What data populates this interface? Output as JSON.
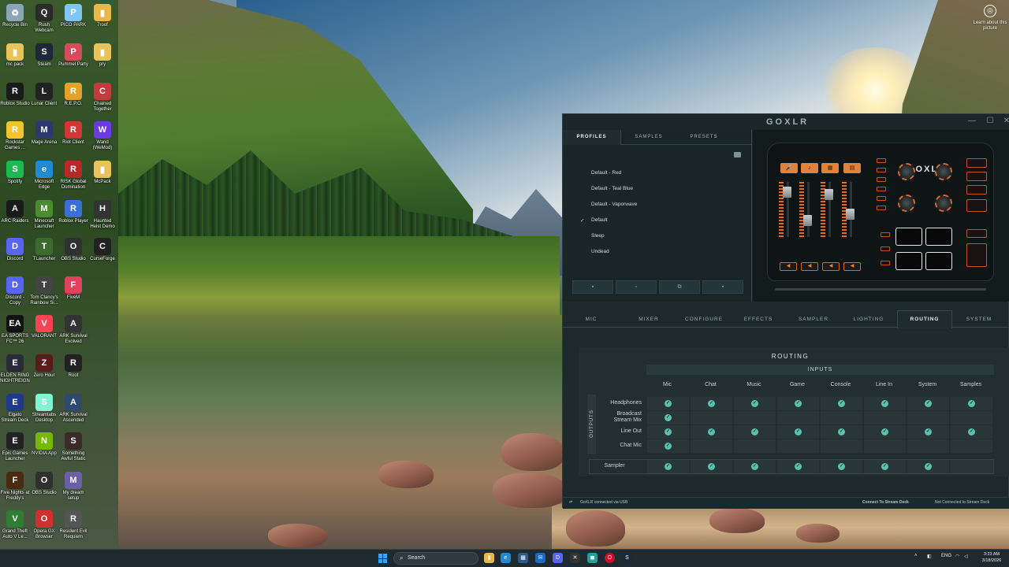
{
  "wallpaper": {
    "learn_more": "Learn about this picture"
  },
  "desktop_icons": [
    {
      "label": "Recycle Bin",
      "color": "#8aa6b8",
      "glyph": "♻"
    },
    {
      "label": "Rush Webcam",
      "color": "#2b2b2b",
      "glyph": "Q"
    },
    {
      "label": "PICO PARK",
      "color": "#7fc7f0",
      "glyph": "P"
    },
    {
      "label": "7roof",
      "color": "#e8b84a",
      "glyph": "▮"
    },
    {
      "label": "mc pack",
      "color": "#e8c25a",
      "glyph": "▮"
    },
    {
      "label": "Steam",
      "color": "#1b2838",
      "glyph": "S"
    },
    {
      "label": "Pummel Party",
      "color": "#d94b5b",
      "glyph": "P"
    },
    {
      "label": "pry",
      "color": "#e8c25a",
      "glyph": "▮"
    },
    {
      "label": "Roblox Studio",
      "color": "#1a1a1a",
      "glyph": "R"
    },
    {
      "label": "Lunar Client",
      "color": "#222",
      "glyph": "L"
    },
    {
      "label": "R.E.P.O.",
      "color": "#e3a32a",
      "glyph": "R"
    },
    {
      "label": "Chained Together",
      "color": "#c43b3b",
      "glyph": "C"
    },
    {
      "label": "Rockstar Games ...",
      "color": "#f4c430",
      "glyph": "R"
    },
    {
      "label": "Mage Arena",
      "color": "#2b3a6b",
      "glyph": "M"
    },
    {
      "label": "Riot Client",
      "color": "#d13639",
      "glyph": "R"
    },
    {
      "label": "Wand (WeMod)",
      "color": "#6a3be0",
      "glyph": "W"
    },
    {
      "label": "Spotify",
      "color": "#1db954",
      "glyph": "S"
    },
    {
      "label": "Microsoft Edge",
      "color": "#1f8ad6",
      "glyph": "e"
    },
    {
      "label": "RISK Global Domination",
      "color": "#b92828",
      "glyph": "R"
    },
    {
      "label": "McPack",
      "color": "#e8c25a",
      "glyph": "▮"
    },
    {
      "label": "ARC Raiders",
      "color": "#1a1a1a",
      "glyph": "A"
    },
    {
      "label": "Minecraft Launcher",
      "color": "#4b8a2e",
      "glyph": "M"
    },
    {
      "label": "Roblox Player",
      "color": "#3a6fd8",
      "glyph": "R"
    },
    {
      "label": "Haunted Heist Demo",
      "color": "#333",
      "glyph": "H"
    },
    {
      "label": "Discord",
      "color": "#5865f2",
      "glyph": "D"
    },
    {
      "label": "TLauncher",
      "color": "#3d6b2d",
      "glyph": "T"
    },
    {
      "label": "OBS Studio",
      "color": "#303030",
      "glyph": "O"
    },
    {
      "label": "CurseForge",
      "color": "#222",
      "glyph": "C"
    },
    {
      "label": "Discord - Copy",
      "color": "#5865f2",
      "glyph": "D"
    },
    {
      "label": "Tom Clancy's Rainbow Si...",
      "color": "#444",
      "glyph": "T"
    },
    {
      "label": "FiveM",
      "color": "#e0415c",
      "glyph": "F"
    },
    {
      "label": "",
      "color": "",
      "glyph": ""
    },
    {
      "label": "EA SPORTS FC™ 26",
      "color": "#111",
      "glyph": "EA"
    },
    {
      "label": "VALORANT",
      "color": "#fa4454",
      "glyph": "V"
    },
    {
      "label": "ARK Survival Evolved",
      "color": "#333",
      "glyph": "A"
    },
    {
      "label": "",
      "color": "",
      "glyph": ""
    },
    {
      "label": "ELDEN RING NIGHTREIGN",
      "color": "#2a2a3a",
      "glyph": "E"
    },
    {
      "label": "Zero Hour",
      "color": "#5a1a1a",
      "glyph": "Z"
    },
    {
      "label": "Root",
      "color": "#222",
      "glyph": "R"
    },
    {
      "label": "",
      "color": "",
      "glyph": ""
    },
    {
      "label": "Elgato Stream Deck",
      "color": "#1e3a8a",
      "glyph": "E"
    },
    {
      "label": "Streamlabs Desktop",
      "color": "#80f5d2",
      "glyph": "S"
    },
    {
      "label": "ARK Survival Ascended",
      "color": "#2d4a6b",
      "glyph": "A"
    },
    {
      "label": "",
      "color": "",
      "glyph": ""
    },
    {
      "label": "Epic Games Launcher",
      "color": "#222",
      "glyph": "E"
    },
    {
      "label": "NVIDIA App",
      "color": "#76b900",
      "glyph": "N"
    },
    {
      "label": "Something Awful Static",
      "color": "#3a2a2a",
      "glyph": "S"
    },
    {
      "label": "",
      "color": "",
      "glyph": ""
    },
    {
      "label": "Five Nights at Freddy's",
      "color": "#4a2a10",
      "glyph": "F"
    },
    {
      "label": "OBS Studio",
      "color": "#303030",
      "glyph": "O"
    },
    {
      "label": "My dream setup",
      "color": "#6b5fa8",
      "glyph": "M"
    },
    {
      "label": "",
      "color": "",
      "glyph": ""
    },
    {
      "label": "Grand Theft Auto V Le...",
      "color": "#2e7d32",
      "glyph": "V"
    },
    {
      "label": "Opera GX Browser",
      "color": "#d32f2f",
      "glyph": "O"
    },
    {
      "label": "Resident Evil Requiem",
      "color": "#555",
      "glyph": "R"
    }
  ],
  "goxlr": {
    "title": "GOXLR",
    "window_buttons": [
      "—",
      "☐",
      "✕"
    ],
    "tabs": [
      "PROFILES",
      "SAMPLES",
      "PRESETS"
    ],
    "profiles": [
      "Default - Red",
      "Default - Teal Blue",
      "Default - Vaporwave",
      "Default",
      "Sleep",
      "Undead"
    ],
    "active_profile_check": "✓",
    "profile_buttons": [
      "💾",
      "📄",
      "⧉",
      "🗑"
    ],
    "device_logo": "GOXLR",
    "nav": [
      "MIC",
      "MIXER",
      "CONFIGURE",
      "EFFECTS",
      "SAMPLER",
      "LIGHTING",
      "ROUTING",
      "SYSTEM"
    ],
    "routing": {
      "title": "ROUTING",
      "inputs_label": "INPUTS",
      "outputs_label": "OUTPUTS",
      "columns": [
        "Mic",
        "Chat",
        "Music",
        "Game",
        "Console",
        "Line In",
        "System",
        "Samples"
      ],
      "rows": [
        {
          "label": "Headphones",
          "checks": [
            true,
            true,
            true,
            true,
            true,
            true,
            true,
            true
          ]
        },
        {
          "label": "Broadcast Stream Mix",
          "checks": [
            true,
            false,
            false,
            false,
            false,
            false,
            false,
            false
          ]
        },
        {
          "label": "Line Out",
          "checks": [
            true,
            true,
            true,
            true,
            true,
            true,
            true,
            true
          ]
        },
        {
          "label": "Chat Mic",
          "checks": [
            true,
            false,
            false,
            false,
            false,
            false,
            false,
            false
          ]
        }
      ],
      "sampler_row": {
        "label": "Sampler",
        "checks": [
          true,
          true,
          true,
          true,
          true,
          true,
          true,
          false
        ]
      }
    },
    "status": {
      "connection": "GoXLR connected via USB",
      "stream_deck_link": "Connect To Stream Deck",
      "stream_deck_status": "Not Connected to Stream Deck"
    }
  },
  "taskbar": {
    "search_placeholder": "Search",
    "language": "ENG",
    "time": "3:23 AM",
    "date": "3/18/2026"
  }
}
